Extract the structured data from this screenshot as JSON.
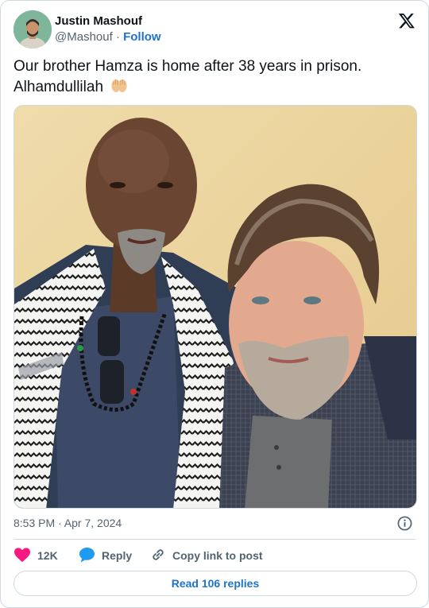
{
  "author": {
    "name": "Justin Mashouf",
    "handle": "@Mashouf",
    "separator": "·",
    "follow_label": "Follow"
  },
  "tweet": {
    "text_line1": "Our brother Hamza is home after 38 years in prison.",
    "text_line2": "Alhamdullilah",
    "emoji": "palms-up-together"
  },
  "timestamp": "8:53 PM · Apr 7, 2024",
  "actions": {
    "like_count": "12K",
    "reply_label": "Reply",
    "copy_link_label": "Copy link to post"
  },
  "read_replies_label": "Read 106 replies",
  "colors": {
    "link": "#1d73c8",
    "like": "#f91880",
    "reply": "#1d9bf0",
    "muted": "#536471",
    "border": "#cfd9de"
  },
  "icons": [
    "x-logo-icon",
    "info-icon",
    "heart-icon",
    "reply-bubble-icon",
    "link-icon"
  ]
}
